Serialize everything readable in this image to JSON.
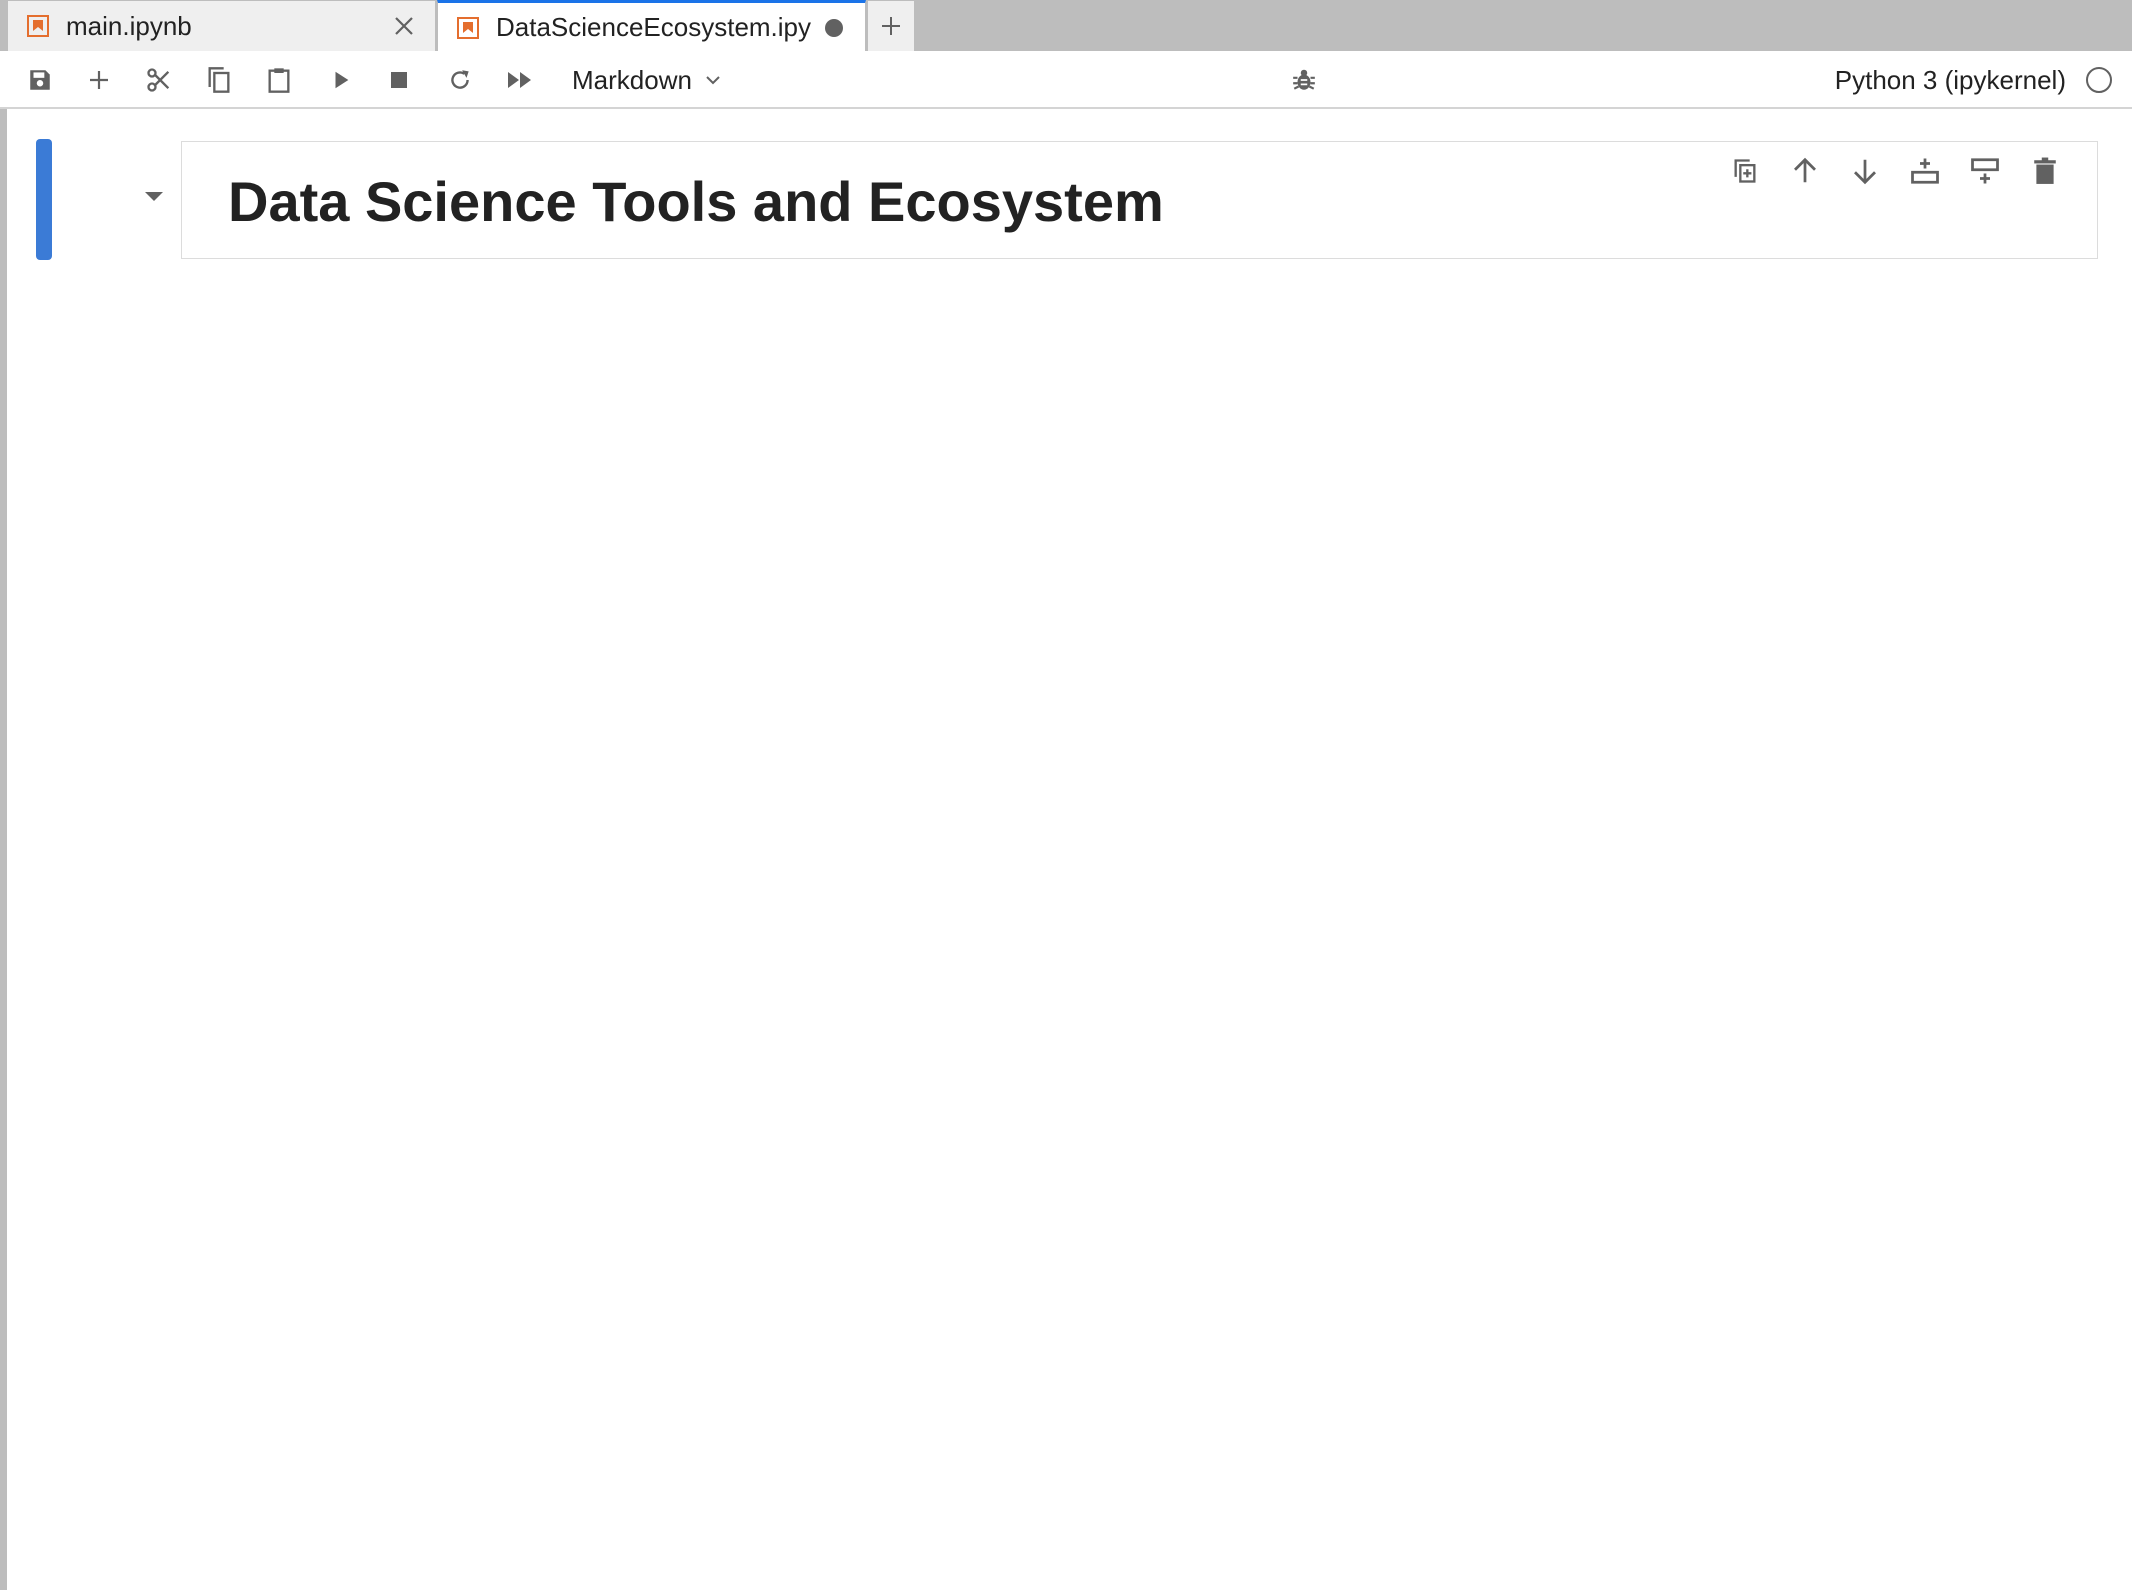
{
  "tabs": [
    {
      "label": "main.ipynb",
      "icon": "notebook-icon",
      "state": "closable"
    },
    {
      "label": "DataScienceEcosystem.ipy",
      "icon": "notebook-icon",
      "state": "unsaved",
      "active": true
    }
  ],
  "toolbar": {
    "buttons": [
      "save-icon",
      "add-cell-icon",
      "cut-icon",
      "copy-icon",
      "paste-icon",
      "run-icon",
      "stop-icon",
      "restart-icon",
      "run-all-icon"
    ],
    "cell_type": "Markdown",
    "kernel_name": "Python 3 (ipykernel)",
    "kernel_status": "idle"
  },
  "cell": {
    "heading": "Data Science Tools and Ecosystem",
    "actions": [
      "duplicate-cell-icon",
      "move-up-icon",
      "move-down-icon",
      "insert-above-icon",
      "insert-below-icon",
      "delete-cell-icon"
    ]
  },
  "colors": {
    "accent": "#1a73e8",
    "cell_indicator": "#3b7bd6",
    "notebook_icon": "#e46e2e",
    "icon_gray": "#616161",
    "tabbar_bg": "#bdbdbd"
  }
}
